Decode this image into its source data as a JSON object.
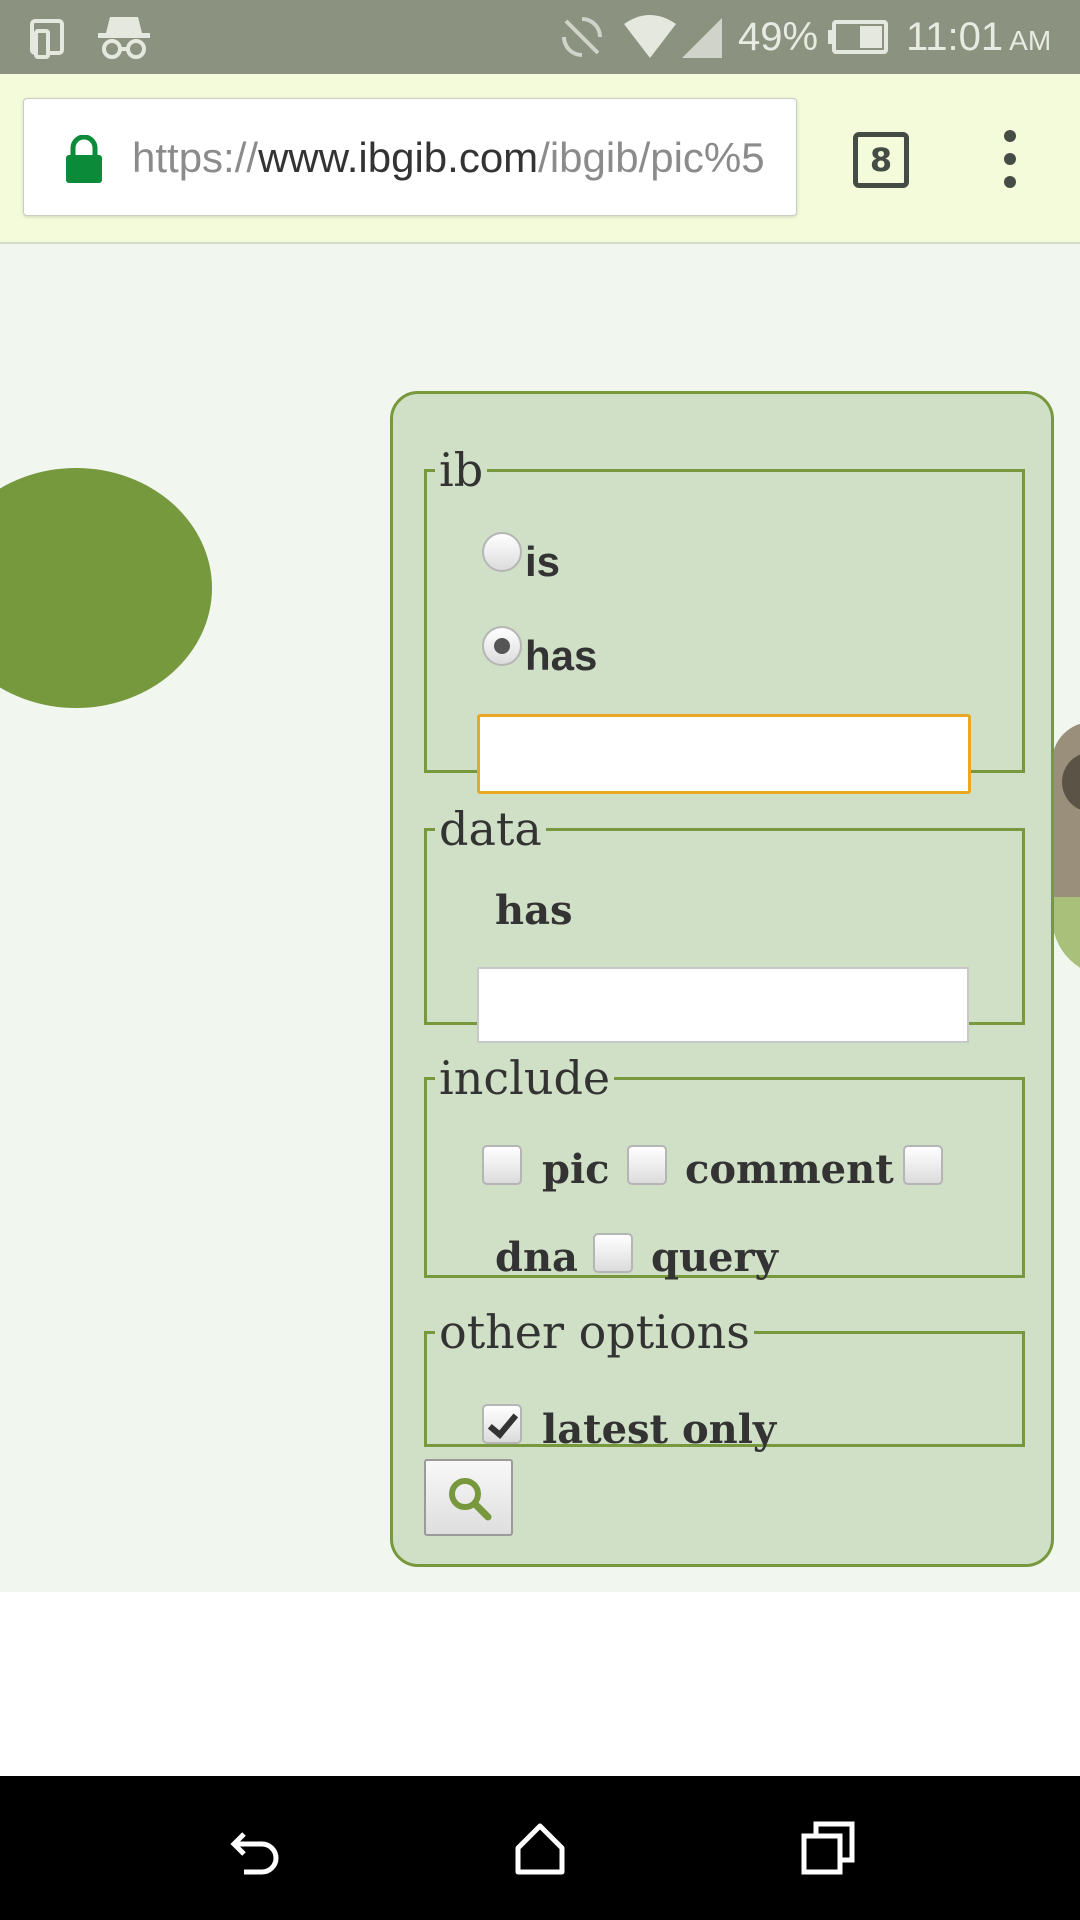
{
  "status_bar": {
    "battery": "49%",
    "time": "11:01",
    "ampm": "AM",
    "icons": [
      "screen-mirror-icon",
      "incognito-icon",
      "sync-off-icon",
      "wifi-icon",
      "signal-icon",
      "battery-icon"
    ]
  },
  "browser": {
    "url_scheme": "https://",
    "url_host": "www.ibgib.com",
    "url_path": "/ibgib/pic%5",
    "tab_count": "8"
  },
  "form": {
    "ib": {
      "legend": "ib",
      "options": [
        {
          "label": "is",
          "checked": false
        },
        {
          "label": "has",
          "checked": true
        }
      ],
      "input_value": ""
    },
    "data": {
      "legend": "data",
      "label": "has",
      "input_value": ""
    },
    "include": {
      "legend": "include",
      "options": [
        {
          "label": "pic",
          "checked": false
        },
        {
          "label": "comment",
          "checked": false
        },
        {
          "label": "dna",
          "checked": false
        },
        {
          "label": "query",
          "checked": false
        }
      ]
    },
    "other_options": {
      "legend": "other options",
      "latest_only_label": "latest only",
      "latest_only_checked": true
    },
    "search_icon": "search-icon"
  },
  "colors": {
    "accent_green": "#78983e",
    "panel_bg": "#d0e0c6",
    "focus_border": "#e8a825",
    "lock_green": "#0b8a3a"
  }
}
